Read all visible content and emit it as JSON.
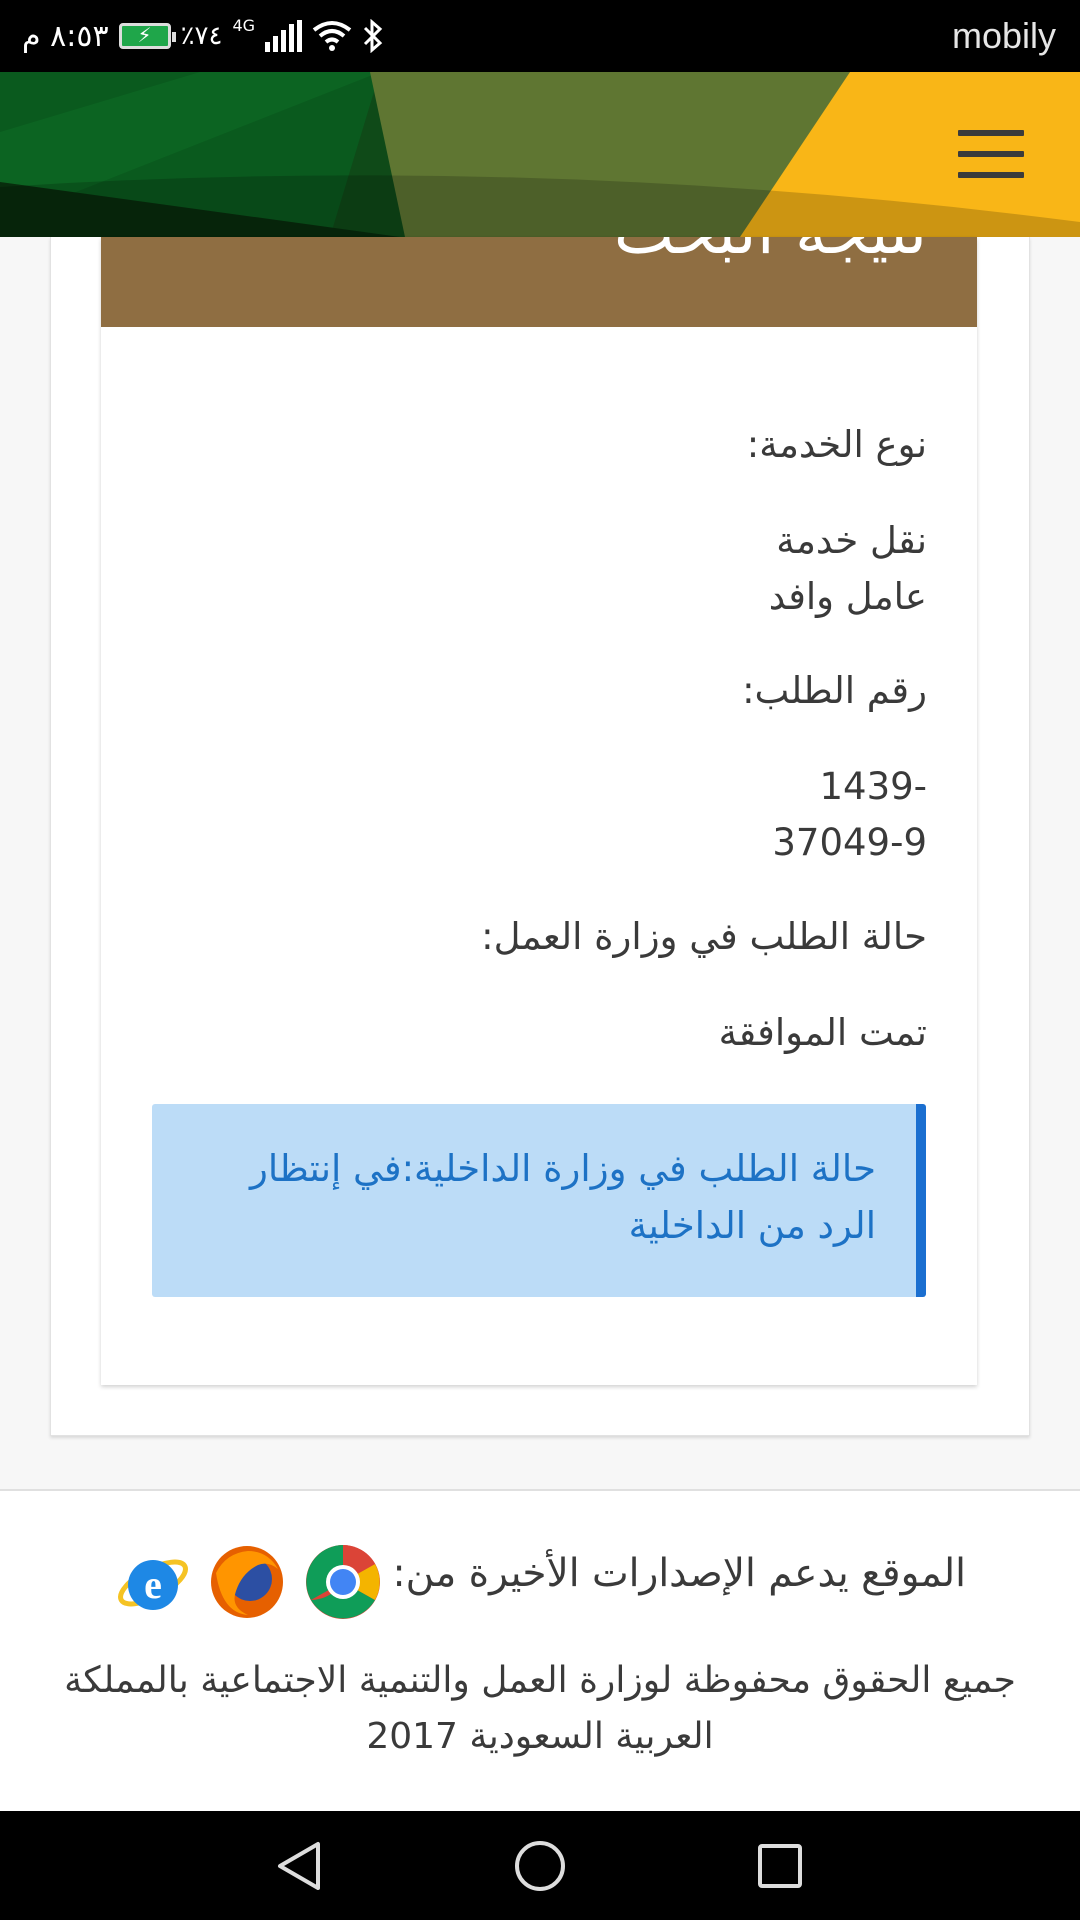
{
  "status_bar": {
    "carrier": "mobily",
    "time": "٨:٥٣ م",
    "battery_percent": "٪٧٤",
    "network": "4G"
  },
  "header": {
    "menu_icon": "hamburger-menu-icon",
    "colors": {
      "dark_green": "#0e3a12",
      "olive": "#5e7530",
      "yellow": "#f9b617"
    }
  },
  "result": {
    "title": "نتيجة البحث",
    "header_color": "#8f6e42",
    "service_type_label": "نوع الخدمة:",
    "service_type_value_line1": "نقل خدمة",
    "service_type_value_line2": "عامل وافد",
    "request_number_label": "رقم الطلب:",
    "request_number_line1": "1439-",
    "request_number_line2": "37049-9",
    "labor_status_label": "حالة الطلب في وزارة العمل:",
    "labor_status_value": "تمت الموافقة",
    "interior_status_line1": "حالة الطلب في وزارة الداخلية:في إنتظار",
    "interior_status_line2": "الرد من الداخلية"
  },
  "footer": {
    "supported_browsers_text": "الموقع يدعم الإصدارات الأخيرة من:",
    "browsers": [
      "chrome-icon",
      "firefox-icon",
      "internet-explorer-icon"
    ],
    "copyright_line1": "جميع الحقوق محفوظة لوزارة العمل والتنمية الاجتماعية بالمملكة",
    "copyright_line2": "العربية السعودية 2017"
  },
  "nav_bar": {
    "buttons": [
      "back-icon",
      "home-icon",
      "recents-icon"
    ]
  }
}
